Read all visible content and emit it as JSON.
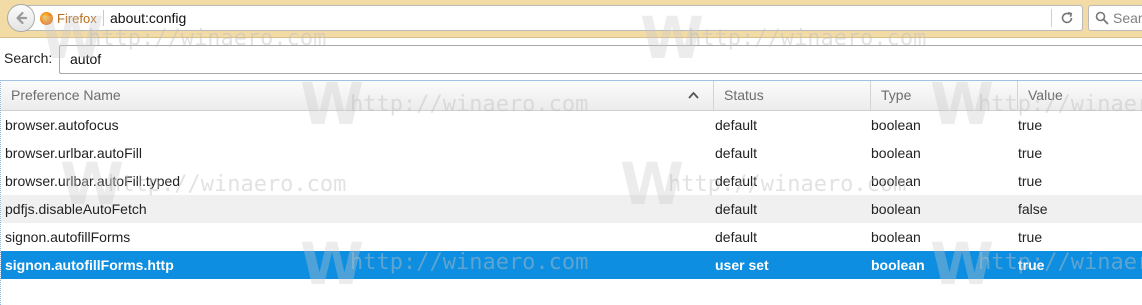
{
  "toolbar": {
    "identity_label": "Firefox",
    "url": "about:config",
    "search_placeholder": "Search"
  },
  "search": {
    "label": "Search:",
    "value": "autof"
  },
  "columns": {
    "name": "Preference Name",
    "status": "Status",
    "type": "Type",
    "value": "Value"
  },
  "rows": [
    {
      "name": "browser.autofocus",
      "status": "default",
      "type": "boolean",
      "value": "true"
    },
    {
      "name": "browser.urlbar.autoFill",
      "status": "default",
      "type": "boolean",
      "value": "true"
    },
    {
      "name": "browser.urlbar.autoFill.typed",
      "status": "default",
      "type": "boolean",
      "value": "true"
    },
    {
      "name": "pdfjs.disableAutoFetch",
      "status": "default",
      "type": "boolean",
      "value": "false"
    },
    {
      "name": "signon.autofillForms",
      "status": "default",
      "type": "boolean",
      "value": "true"
    },
    {
      "name": "signon.autofillForms.http",
      "status": "user set",
      "type": "boolean",
      "value": "true"
    }
  ],
  "selected_row": 5,
  "watermark": {
    "text": "http://winaero.com"
  },
  "colors": {
    "toolbar_bg": "#f3dba6",
    "selection": "#0d8ee0",
    "identity_text": "#b96a1a"
  }
}
